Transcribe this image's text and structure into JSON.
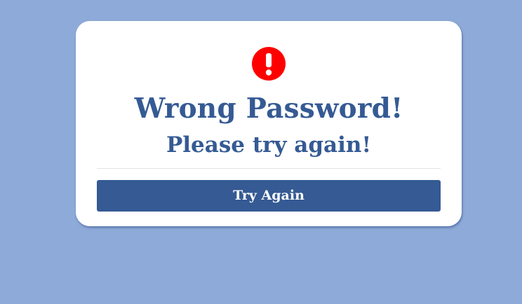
{
  "dialog": {
    "title": "Wrong Password!",
    "subtitle": "Please try again!",
    "icon": "exclamation-circle-icon",
    "button_label": "Try Again"
  },
  "colors": {
    "page_background": "#8eaad8",
    "card_background": "#ffffff",
    "accent": "#355a94",
    "alert_icon": "#ff0000"
  }
}
